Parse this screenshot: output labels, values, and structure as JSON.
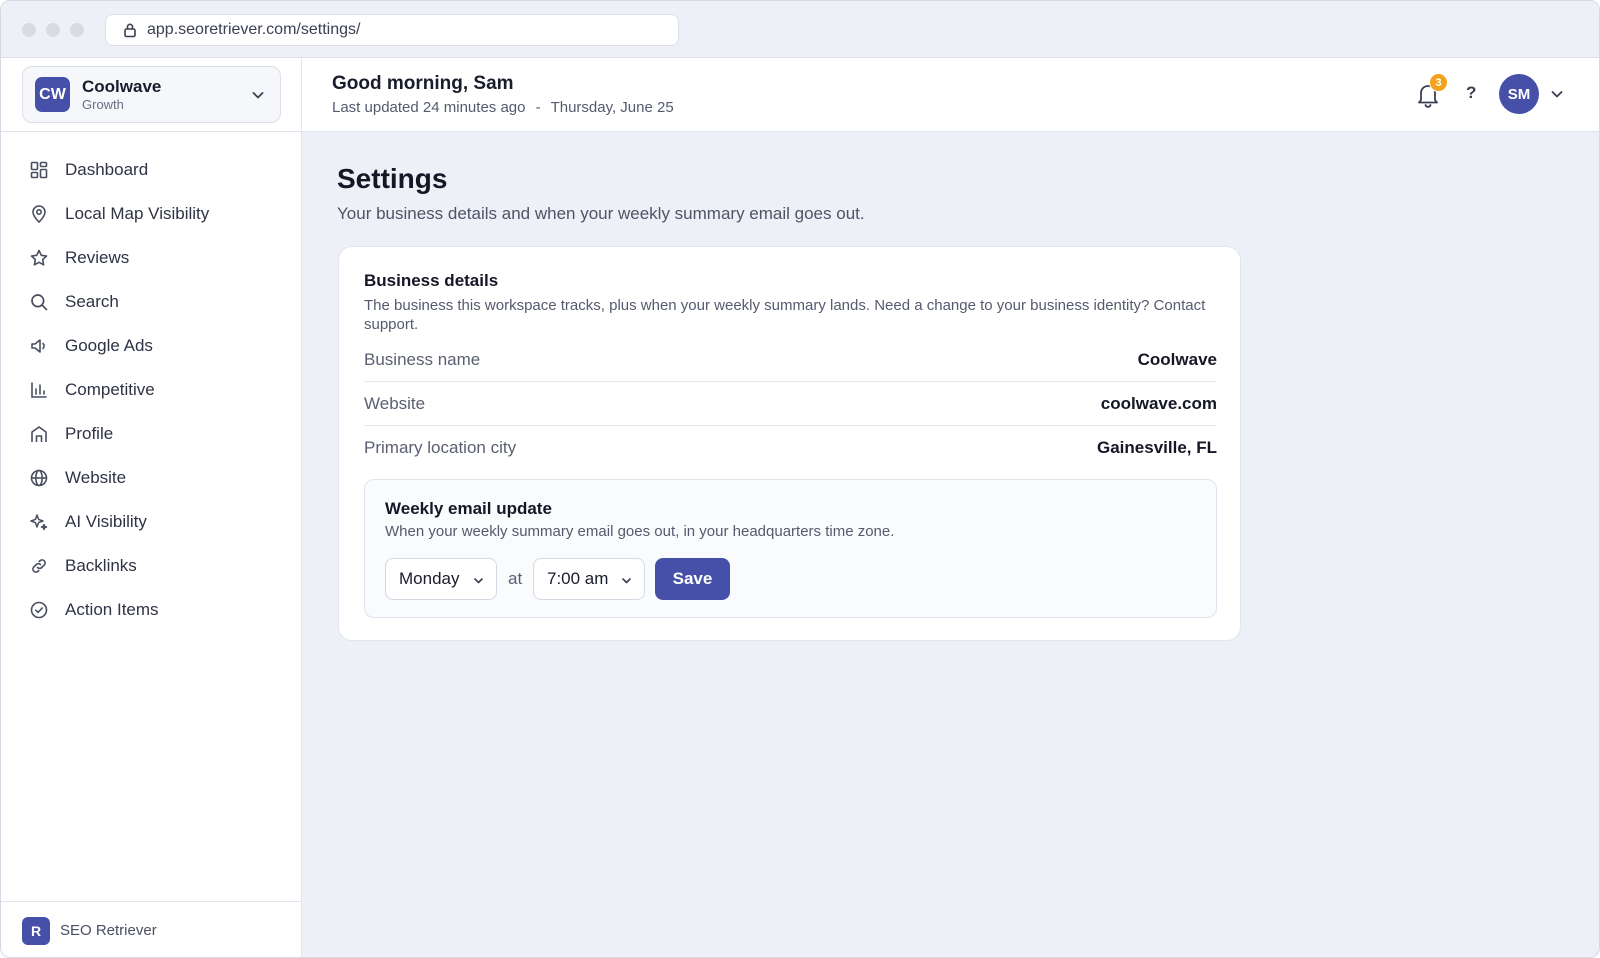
{
  "browser": {
    "url": "app.seoretriever.com/settings/"
  },
  "workspace": {
    "initials": "CW",
    "name": "Coolwave",
    "plan": "Growth"
  },
  "sidebar": {
    "items": [
      {
        "label": "Dashboard",
        "icon": "dashboard-icon"
      },
      {
        "label": "Local Map Visibility",
        "icon": "map-pin-icon"
      },
      {
        "label": "Reviews",
        "icon": "star-icon"
      },
      {
        "label": "Search",
        "icon": "search-icon"
      },
      {
        "label": "Google Ads",
        "icon": "megaphone-icon"
      },
      {
        "label": "Competitive",
        "icon": "bar-chart-icon"
      },
      {
        "label": "Profile",
        "icon": "storefront-icon"
      },
      {
        "label": "Website",
        "icon": "globe-icon"
      },
      {
        "label": "AI Visibility",
        "icon": "sparkle-icon"
      },
      {
        "label": "Backlinks",
        "icon": "link-icon"
      },
      {
        "label": "Action Items",
        "icon": "check-circle-icon"
      }
    ],
    "footer": {
      "logo_letter": "R",
      "brand": "SEO Retriever"
    }
  },
  "header": {
    "greeting": "Good morning, Sam",
    "updated": "Last updated 24 minutes ago",
    "separator": "-",
    "date": "Thursday, June 25",
    "notification_count": "3",
    "help_label": "?",
    "avatar_initials": "SM"
  },
  "page": {
    "title": "Settings",
    "subtitle": "Your business details and when your weekly summary email goes out."
  },
  "business": {
    "title": "Business details",
    "description": "The business this workspace tracks, plus when your weekly summary lands. Need a change to your business identity? Contact support.",
    "rows": [
      {
        "label": "Business name",
        "value": "Coolwave"
      },
      {
        "label": "Website",
        "value": "coolwave.com"
      },
      {
        "label": "Primary location city",
        "value": "Gainesville, FL"
      }
    ]
  },
  "email": {
    "title": "Weekly email update",
    "description": "When your weekly summary email goes out, in your headquarters time zone.",
    "day": "Monday",
    "at_label": "at",
    "time": "7:00 am",
    "save_label": "Save"
  },
  "colors": {
    "accent": "#4650a8",
    "badge": "#f2a21b",
    "background": "#eef0f8"
  }
}
